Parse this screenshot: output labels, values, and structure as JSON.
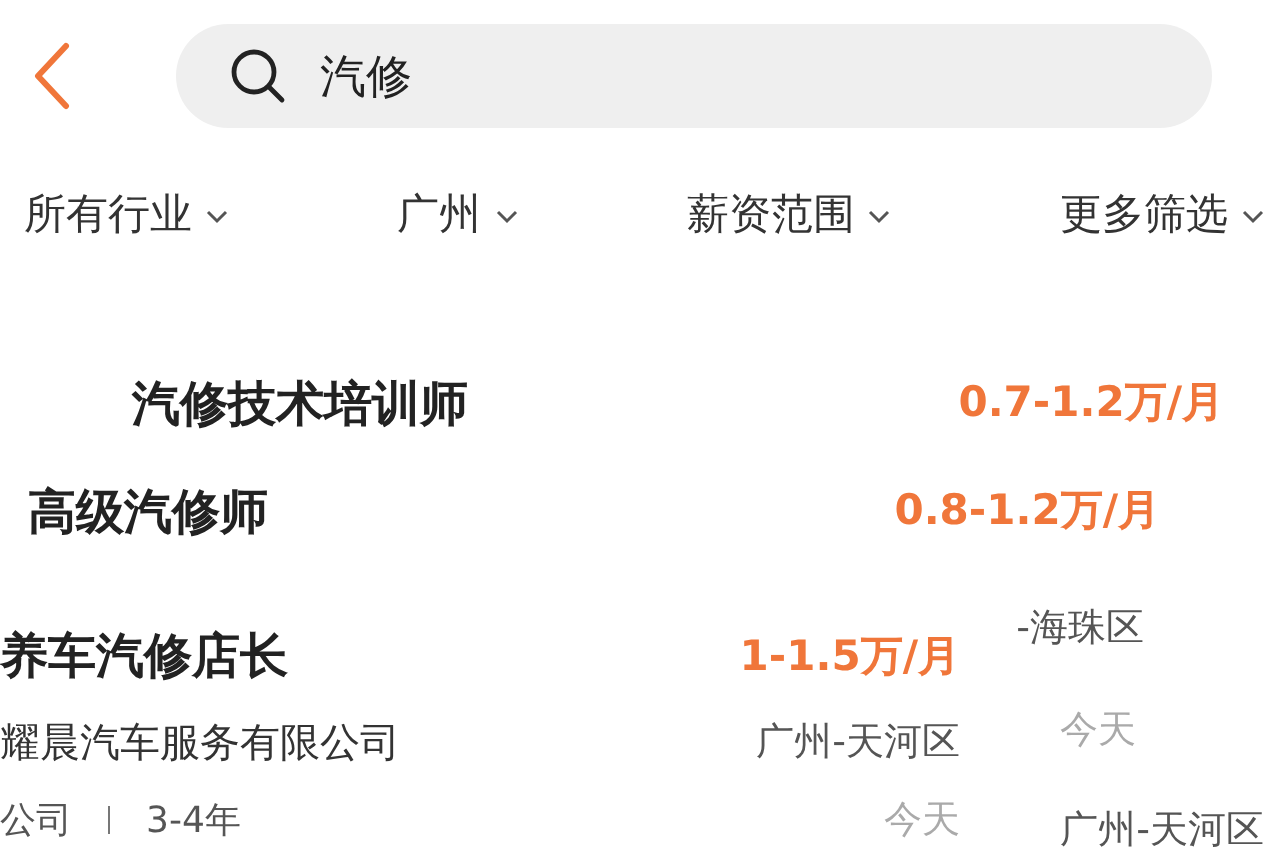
{
  "search": {
    "value": "汽修"
  },
  "filters": [
    {
      "label": "所有行业"
    },
    {
      "label": "广州"
    },
    {
      "label": "薪资范围"
    },
    {
      "label": "更多筛选"
    }
  ],
  "jobs": [
    {
      "title": "汽修技术培训师",
      "salary": "0.7-1.2万/月"
    },
    {
      "title": "高级汽修师",
      "salary": "0.8-1.2万/月",
      "location": "-海珠区",
      "date": "今天"
    },
    {
      "title": "养车汽修店长",
      "salary": "1-1.5万/月",
      "company": "耀晨汽车服务有限公司",
      "location": "广州-天河区",
      "meta": [
        "公司",
        "3-4年"
      ],
      "date": "今天"
    },
    {
      "location": "广州-天河区"
    }
  ]
}
